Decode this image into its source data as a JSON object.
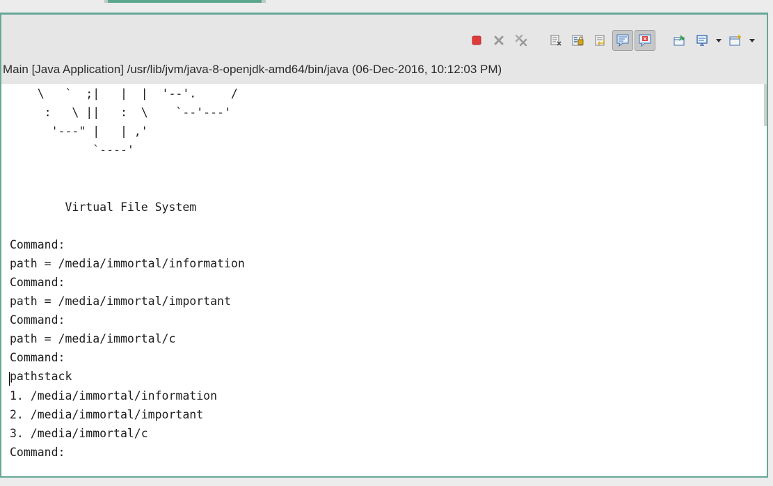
{
  "console": {
    "process_label": "Main [Java Application] /usr/lib/jvm/java-8-openjdk-amd64/bin/java (06-Dec-2016, 10:12:03 PM)",
    "output": "    \\   `  ;|   |  |  '--'.     /\n     :   \\ ||   :  \\    `--'---'\n      '---\" |   | ,'\n            `----'\n\n\n        Virtual File System\n\nCommand:\npath = /media/immortal/information\nCommand:\npath = /media/immortal/important\nCommand:\npath = /media/immortal/c\nCommand:\npathstack\n1. /media/immortal/information\n2. /media/immortal/important\n3. /media/immortal/c\nCommand:"
  },
  "toolbar": {
    "buttons": [
      {
        "name": "terminate",
        "icon": "terminate-icon",
        "color": "#e03b3b"
      },
      {
        "name": "remove-launch",
        "icon": "remove-launch-icon"
      },
      {
        "name": "remove-all-terminated",
        "icon": "remove-all-terminated-icon"
      },
      {
        "name": "clear-console",
        "icon": "clear-console-icon"
      },
      {
        "name": "scroll-lock",
        "icon": "scroll-lock-icon"
      },
      {
        "name": "word-wrap",
        "icon": "word-wrap-icon"
      },
      {
        "name": "show-console-on-stdout",
        "icon": "stdout-icon",
        "toggled": true
      },
      {
        "name": "show-console-on-stderr",
        "icon": "stderr-icon",
        "toggled": true
      },
      {
        "name": "pin-console",
        "icon": "pin-console-icon"
      },
      {
        "name": "display-selected-console",
        "icon": "display-console-icon"
      },
      {
        "name": "open-console",
        "icon": "open-console-icon"
      }
    ]
  },
  "colors": {
    "accent": "#66a796",
    "terminate_red": "#e03b3b"
  }
}
